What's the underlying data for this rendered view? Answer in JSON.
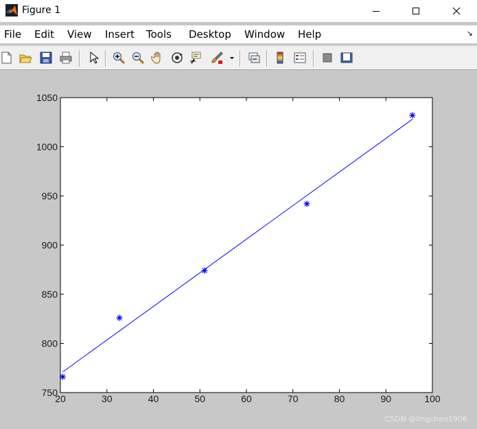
{
  "window": {
    "title": "Figure 1"
  },
  "menu": [
    "File",
    "Edit",
    "View",
    "Insert",
    "Tools",
    "Desktop",
    "Window",
    "Help"
  ],
  "toolbar": [
    "new-figure",
    "open-file",
    "save",
    "print",
    "select-arrow",
    "zoom-in",
    "zoom-out",
    "pan",
    "rotate-3d",
    "data-cursor",
    "brush",
    "link-plot",
    "colorbar",
    "legend",
    "hide-plot-tools",
    "show-plot-tools"
  ],
  "watermark": "CSDN @lingchen1906",
  "chart_data": {
    "type": "scatter",
    "xlim": [
      20,
      100
    ],
    "ylim": [
      750,
      1050
    ],
    "xticks": [
      20,
      30,
      40,
      50,
      60,
      70,
      80,
      90,
      100
    ],
    "yticks": [
      750,
      800,
      850,
      900,
      950,
      1000,
      1050
    ],
    "grid": false,
    "series": [
      {
        "kind": "markers",
        "marker": "*",
        "color": "#0000ff",
        "points": [
          [
            20.5,
            766
          ],
          [
            32.7,
            826
          ],
          [
            51.0,
            874
          ],
          [
            73.0,
            942
          ],
          [
            95.7,
            1032
          ]
        ]
      },
      {
        "kind": "line",
        "color": "#0000ff",
        "points": [
          [
            20.5,
            771
          ],
          [
            95.7,
            1028
          ]
        ]
      }
    ]
  }
}
